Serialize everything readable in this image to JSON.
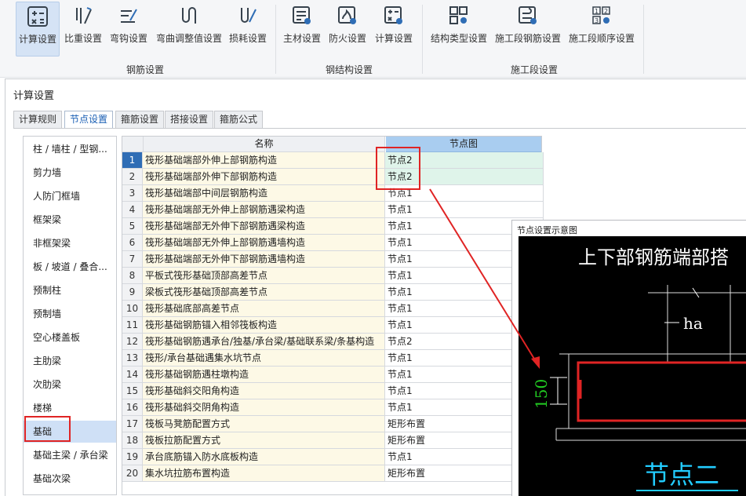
{
  "ribbon": {
    "buttons": [
      {
        "label": "计算设置",
        "icon": "calc-settings-icon"
      },
      {
        "label": "比重设置",
        "icon": "density-settings-icon"
      },
      {
        "label": "弯钩设置",
        "icon": "hook-settings-icon"
      },
      {
        "label": "弯曲调整值设置",
        "icon": "bend-adjust-icon"
      },
      {
        "label": "损耗设置",
        "icon": "loss-settings-icon"
      },
      {
        "label": "主材设置",
        "icon": "main-material-icon"
      },
      {
        "label": "防火设置",
        "icon": "fireproof-icon"
      },
      {
        "label": "计算设置",
        "icon": "steel-calc-settings-icon"
      },
      {
        "label": "结构类型设置",
        "icon": "structure-type-icon"
      },
      {
        "label": "施工段钢筋设置",
        "icon": "segment-rebar-icon"
      },
      {
        "label": "施工段顺序设置",
        "icon": "segment-order-icon"
      }
    ],
    "groups": [
      "钢筋设置",
      "钢结构设置",
      "施工段设置"
    ]
  },
  "dialog": {
    "title": "计算设置",
    "tabs": [
      "计算规则",
      "节点设置",
      "箍筋设置",
      "搭接设置",
      "箍筋公式"
    ],
    "active_tab": 1
  },
  "categories": [
    "柱 / 墙柱 / 型钢...",
    "剪力墙",
    "人防门框墙",
    "框架梁",
    "非框架梁",
    "板 / 坡道 / 叠合...",
    "预制柱",
    "预制墙",
    "空心楼盖板",
    "主肋梁",
    "次肋梁",
    "楼梯",
    "基础",
    "基础主梁 / 承台梁",
    "基础次梁"
  ],
  "selected_category": 12,
  "table": {
    "headers": {
      "name": "名称",
      "node": "节点图"
    },
    "rows": [
      {
        "num": "1",
        "name": "筏形基础端部外伸上部钢筋构造",
        "node": "节点2"
      },
      {
        "num": "2",
        "name": "筏形基础端部外伸下部钢筋构造",
        "node": "节点2"
      },
      {
        "num": "3",
        "name": "筏形基础端部中间层钢筋构造",
        "node": "节点1"
      },
      {
        "num": "4",
        "name": "筏形基础端部无外伸上部钢筋遇梁构造",
        "node": "节点1"
      },
      {
        "num": "5",
        "name": "筏形基础端部无外伸下部钢筋遇梁构造",
        "node": "节点1"
      },
      {
        "num": "6",
        "name": "筏形基础端部无外伸上部钢筋遇墙构造",
        "node": "节点1"
      },
      {
        "num": "7",
        "name": "筏形基础端部无外伸下部钢筋遇墙构造",
        "node": "节点1"
      },
      {
        "num": "8",
        "name": "平板式筏形基础顶部高差节点",
        "node": "节点1"
      },
      {
        "num": "9",
        "name": "梁板式筏形基础顶部高差节点",
        "node": "节点1"
      },
      {
        "num": "10",
        "name": "筏形基础底部高差节点",
        "node": "节点1"
      },
      {
        "num": "11",
        "name": "筏形基础钢筋锚入相邻筏板构造",
        "node": "节点1"
      },
      {
        "num": "12",
        "name": "筏形基础钢筋遇承台/独基/承台梁/基础联系梁/条基构造",
        "node": "节点2"
      },
      {
        "num": "13",
        "name": "筏形/承台基础遇集水坑节点",
        "node": "节点1"
      },
      {
        "num": "14",
        "name": "筏形基础钢筋遇柱墩构造",
        "node": "节点1"
      },
      {
        "num": "15",
        "name": "筏形基础斜交阳角构造",
        "node": "节点1"
      },
      {
        "num": "16",
        "name": "筏形基础斜交阴角构造",
        "node": "节点1"
      },
      {
        "num": "17",
        "name": "筏板马凳筋配置方式",
        "node": "矩形布置"
      },
      {
        "num": "18",
        "name": "筏板拉筋配置方式",
        "node": "矩形布置"
      },
      {
        "num": "19",
        "name": "承台底筋锚入防水底板构造",
        "node": "节点1"
      },
      {
        "num": "20",
        "name": "集水坑拉筋布置构造",
        "node": "矩形布置"
      }
    ]
  },
  "preview": {
    "title": "节点设置示意图",
    "drawing_title": "上下部钢筋端部搭",
    "dim_ha": "ha",
    "dim_150": "150",
    "caption": "节点二"
  },
  "colors": {
    "accent": "#2f6db5",
    "annotation": "#e02424",
    "cad_green": "#22cc22",
    "cad_cyan": "#22ccff"
  }
}
